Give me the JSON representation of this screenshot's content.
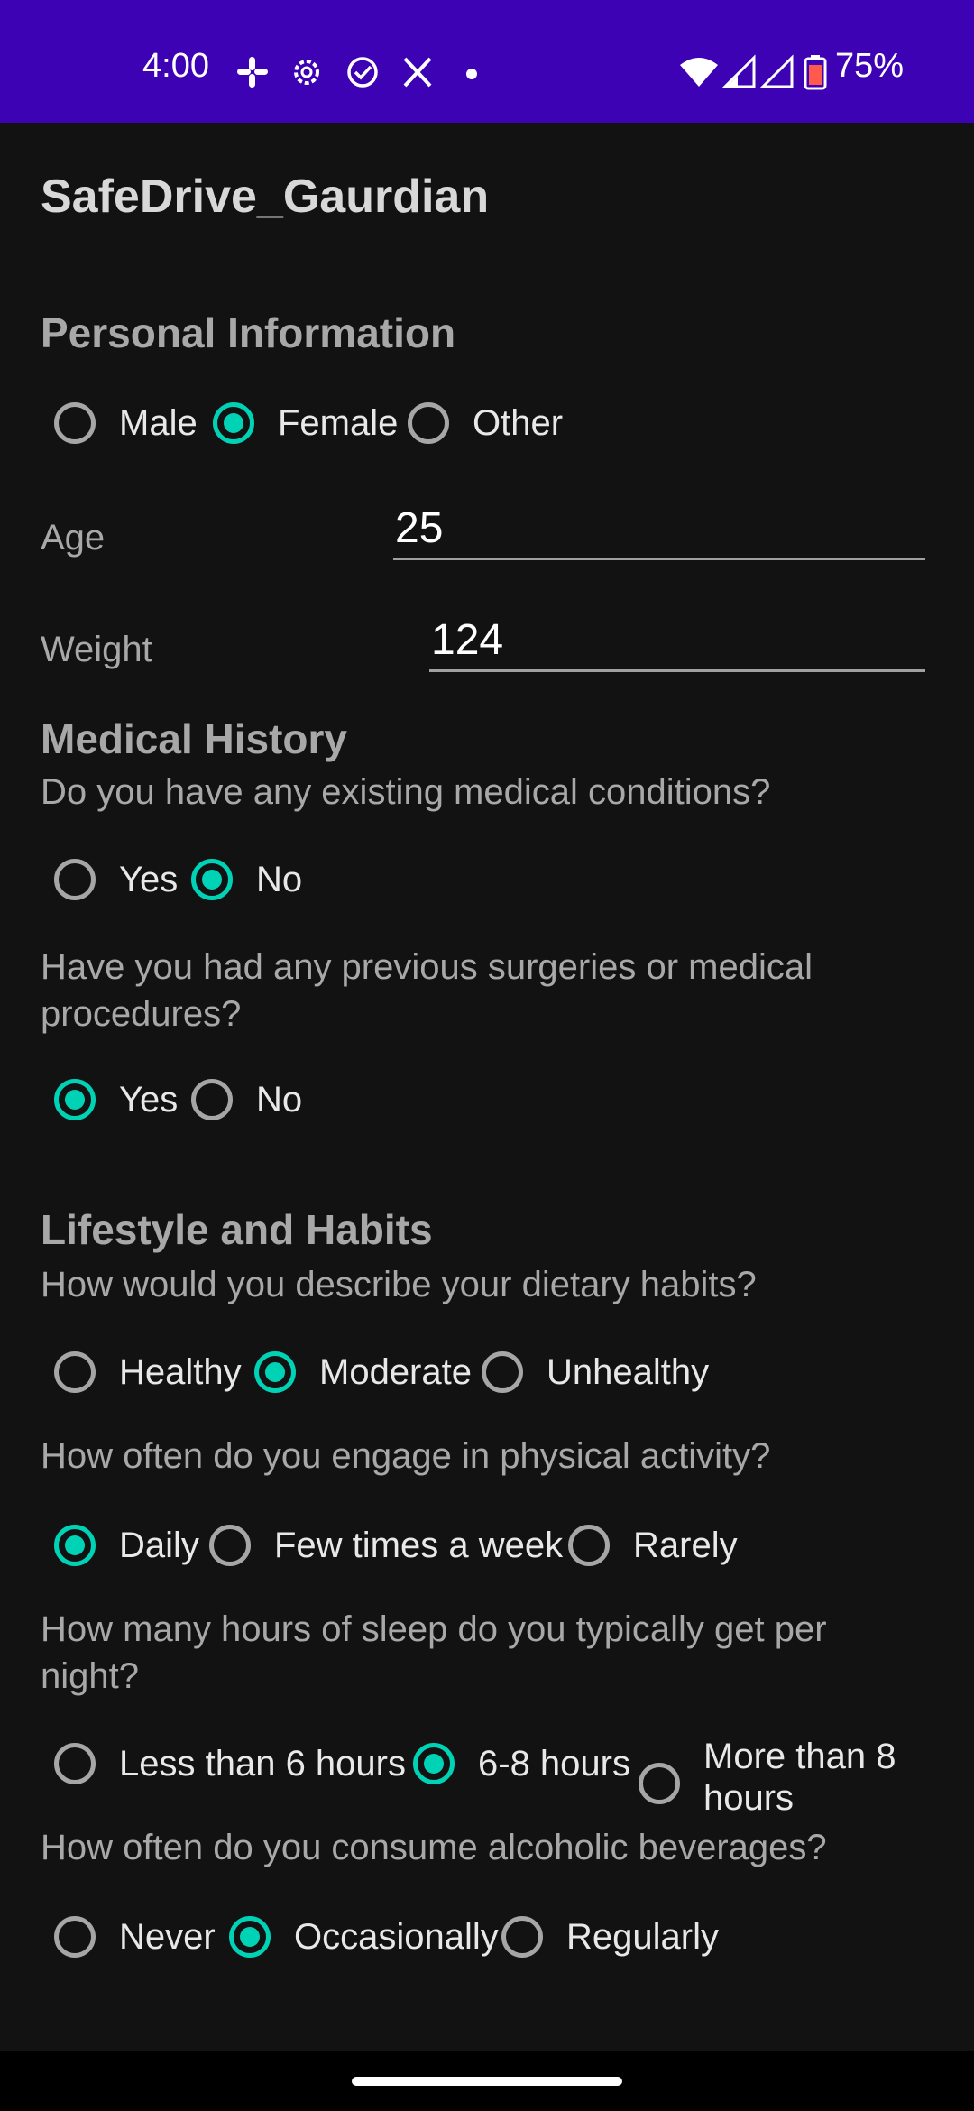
{
  "status_bar": {
    "time": "4:00",
    "battery": "75%",
    "icons": [
      "slack-icon",
      "settings-icon",
      "check-circle-icon",
      "x-logo-icon",
      "dot-icon",
      "wifi-icon",
      "signal-icon",
      "signal-icon",
      "battery-icon"
    ],
    "background": "#3d02b3"
  },
  "app": {
    "title": "SafeDrive_Gaurdian"
  },
  "personal": {
    "heading": "Personal Information",
    "gender": {
      "options": [
        "Male",
        "Female",
        "Other"
      ],
      "selected": "Female"
    },
    "age": {
      "label": "Age",
      "value": "25"
    },
    "weight": {
      "label": "Weight",
      "value": "124"
    }
  },
  "medical": {
    "heading": "Medical History",
    "q1": {
      "text": "Do you have any existing medical conditions?",
      "options": [
        "Yes",
        "No"
      ],
      "selected": "No"
    },
    "q2": {
      "text": "Have you had any previous surgeries or medical procedures?",
      "options": [
        "Yes",
        "No"
      ],
      "selected": "Yes"
    }
  },
  "lifestyle": {
    "heading": "Lifestyle and Habits",
    "diet": {
      "text": "How would you describe your dietary habits?",
      "options": [
        "Healthy",
        "Moderate",
        "Unhealthy"
      ],
      "selected": "Moderate"
    },
    "activity": {
      "text": "How often do you engage in physical activity?",
      "options": [
        "Daily",
        "Few times a week",
        "Rarely"
      ],
      "selected": "Daily"
    },
    "sleep": {
      "text": "How many hours of sleep do you typically get per night?",
      "options": [
        "Less than 6 hours",
        "6-8 hours",
        "More than 8 hours"
      ],
      "selected": "6-8 hours"
    },
    "alcohol": {
      "text": "How often do you consume alcoholic beverages?",
      "options": [
        "Never",
        "Occasionally",
        "Regularly"
      ],
      "selected": "Occasionally"
    }
  },
  "accent_color": "#00d3b5"
}
